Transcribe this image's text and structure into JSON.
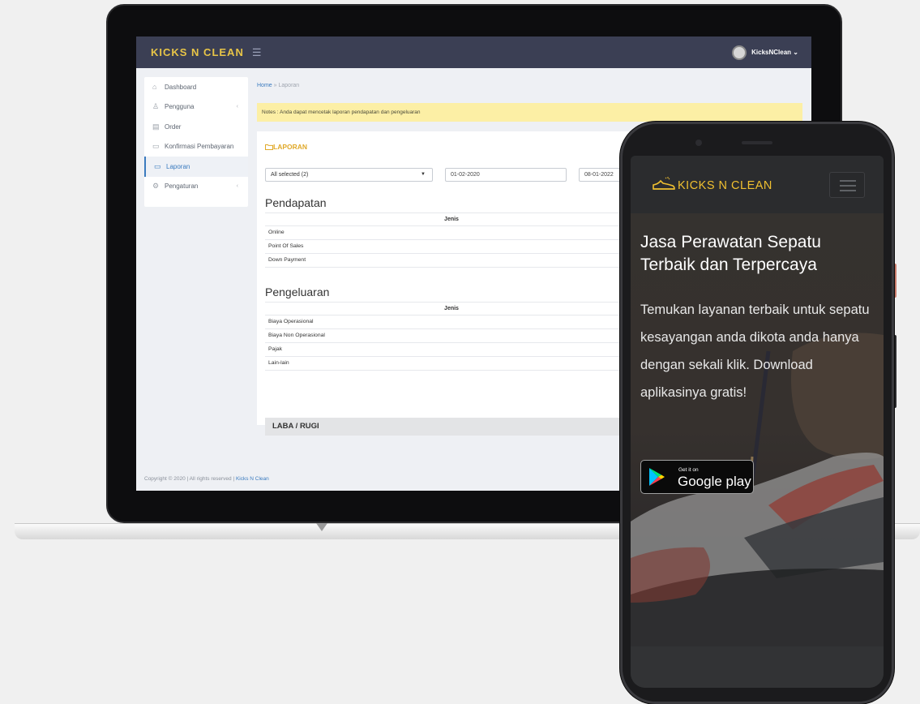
{
  "admin": {
    "brand": "KICKS N CLEAN",
    "menu_icon": "☰",
    "user_name": "KicksNClean",
    "user_caret": "⌄",
    "sidebar": [
      {
        "icon": "⌂",
        "label": "Dashboard",
        "chevron": ""
      },
      {
        "icon": "♙",
        "label": "Pengguna",
        "chevron": "‹"
      },
      {
        "icon": "▤",
        "label": "Order",
        "chevron": ""
      },
      {
        "icon": "▭",
        "label": "Konfirmasi Pembayaran",
        "chevron": ""
      },
      {
        "icon": "▭",
        "label": "Laporan",
        "chevron": ""
      },
      {
        "icon": "⚙",
        "label": "Pengaturan",
        "chevron": "‹"
      }
    ],
    "breadcrumb": {
      "home": "Home",
      "sep": "»",
      "current": "Laporan"
    },
    "notes": "Notes : Anda dapat mencetak laporan pendapatan dan pengeluaran",
    "panel_title": "LAPORAN",
    "filter": {
      "select_value": "All selected (2)",
      "select_caret": "▼",
      "date_from": "01-02-2020",
      "date_to": "08-01-2022"
    },
    "pendapatan": {
      "title": "Pendapatan",
      "header": "Jenis",
      "rows": [
        "Online",
        "Point Of Sales",
        "Down Payment"
      ]
    },
    "pengeluaran": {
      "title": "Pengeluaran",
      "header": "Jenis",
      "rows": [
        "Biaya Operasional",
        "Biaya Non Operasional",
        "Pajak",
        "Lain-lain"
      ]
    },
    "laba_rugi": "LABA / RUGI",
    "copyright": "Copyright © 2020 | All rights reserved |",
    "copyright_link": "Kicks N Clean"
  },
  "mobile": {
    "brand": "KICKS N CLEAN",
    "hero_title": "Jasa Perawatan Sepatu Terbaik dan Terpercaya",
    "hero_text": "Temukan layanan terbaik untuk sepatu kesayangan anda dikota anda hanya dengan sekali klik. Download aplikasinya gratis!",
    "gplay_small": "Get it on",
    "gplay_big": "Google play"
  }
}
